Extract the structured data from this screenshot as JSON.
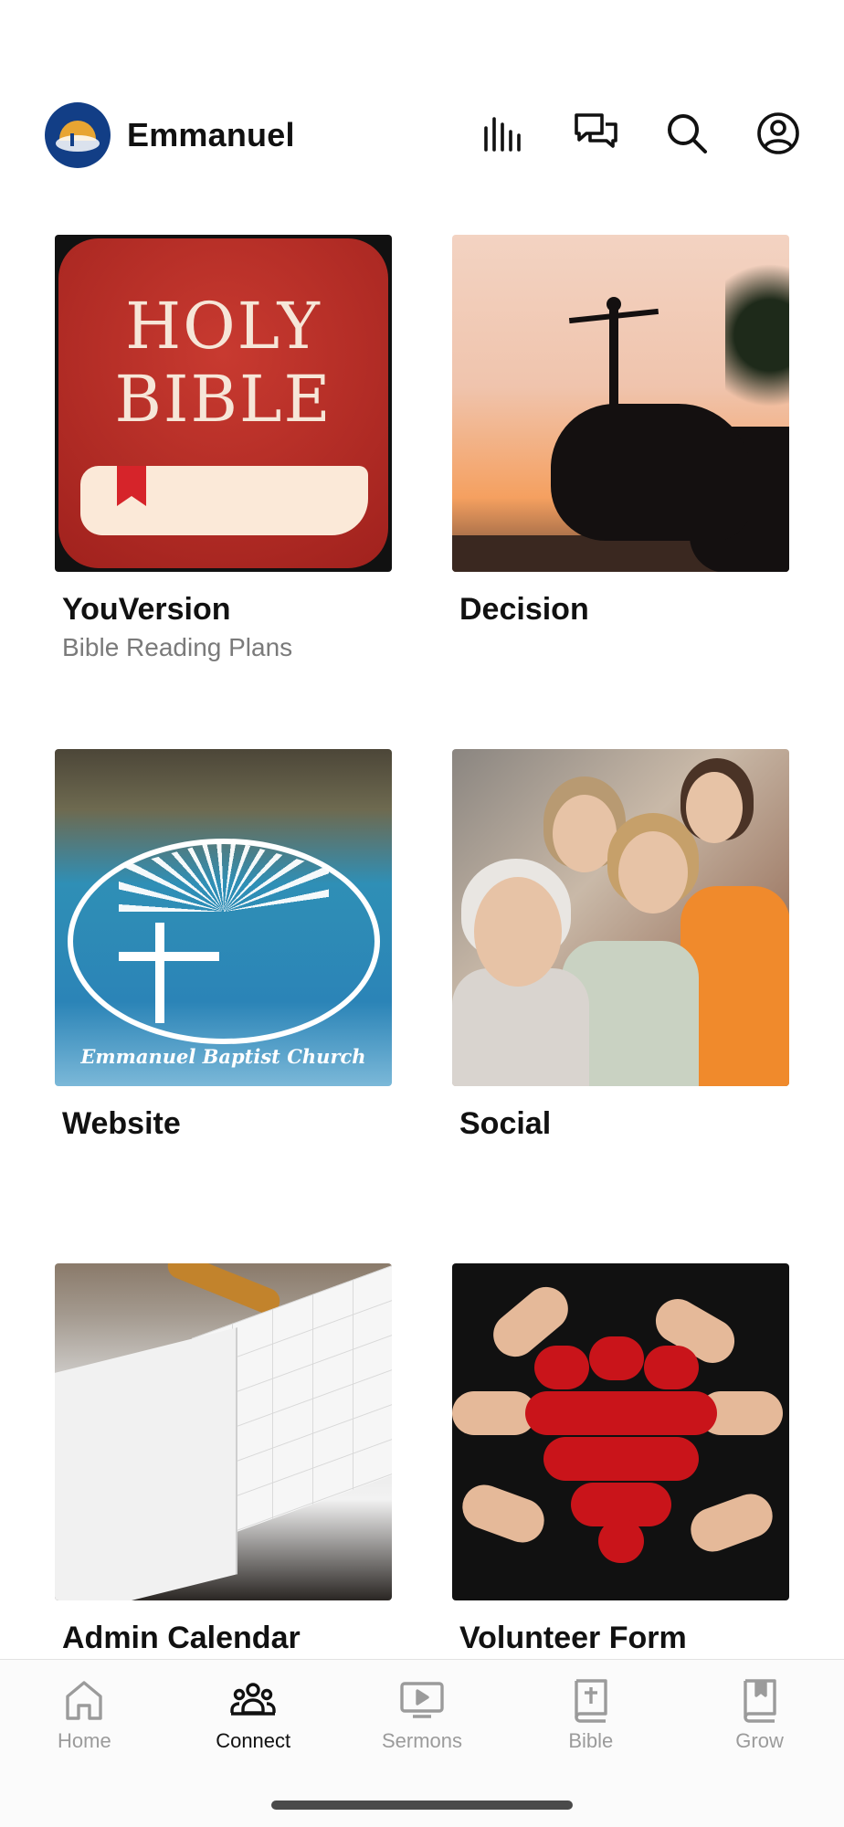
{
  "header": {
    "app_name": "Emmanuel",
    "icons": [
      "audio-bars-icon",
      "chat-bubbles-icon",
      "search-icon",
      "profile-icon"
    ]
  },
  "cards": [
    {
      "title": "YouVersion",
      "subtitle": "Bible Reading Plans",
      "image": "holy-bible-app-logo",
      "image_text": "HOLY BIBLE"
    },
    {
      "title": "Decision",
      "subtitle": "",
      "image": "person-on-rock-silhouette"
    },
    {
      "title": "Website",
      "subtitle": "",
      "image": "church-logo-water",
      "image_text": "Emmanuel Baptist Church"
    },
    {
      "title": "Social",
      "subtitle": "",
      "image": "group-of-women-photo"
    },
    {
      "title": "Admin Calendar",
      "subtitle": "",
      "image": "open-planner-photo"
    },
    {
      "title": "Volunteer Form",
      "subtitle": "",
      "image": "hands-red-heart-photo"
    }
  ],
  "tabbar": {
    "items": [
      {
        "label": "Home",
        "icon": "home-icon",
        "active": false
      },
      {
        "label": "Connect",
        "icon": "people-icon",
        "active": true
      },
      {
        "label": "Sermons",
        "icon": "play-screen-icon",
        "active": false
      },
      {
        "label": "Bible",
        "icon": "bible-book-icon",
        "active": false
      },
      {
        "label": "Grow",
        "icon": "bookmark-book-icon",
        "active": false
      }
    ]
  },
  "colors": {
    "active_tab": "#111111",
    "inactive_tab": "#9b9b9b",
    "subtitle": "#7a7a7a"
  }
}
